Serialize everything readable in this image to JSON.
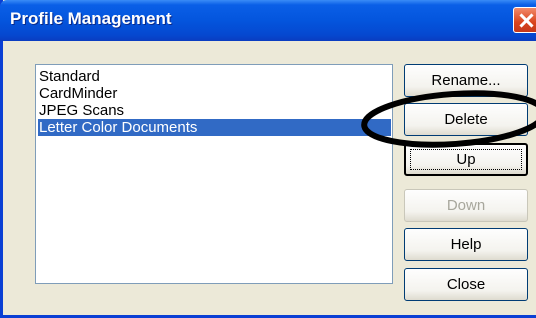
{
  "window": {
    "title": "Profile Management"
  },
  "profiles": {
    "items": [
      {
        "label": "Standard",
        "selected": false
      },
      {
        "label": "CardMinder",
        "selected": false
      },
      {
        "label": "JPEG Scans",
        "selected": false
      },
      {
        "label": "Letter Color Documents",
        "selected": true
      }
    ]
  },
  "buttons": {
    "rename": "Rename...",
    "delete": "Delete",
    "up": "Up",
    "down": "Down",
    "help": "Help",
    "close": "Close"
  },
  "states": {
    "down_enabled": false
  },
  "colors": {
    "selection": "#316ac5",
    "titlebar": "#0455dd",
    "annotation": "#000000"
  }
}
